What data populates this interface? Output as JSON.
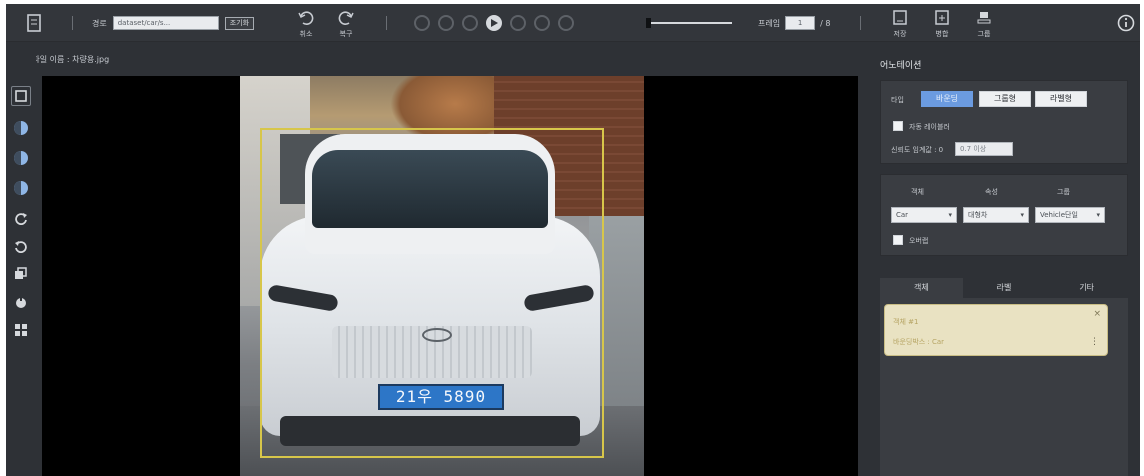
{
  "toolbar": {
    "path_label": "경로",
    "path_value": "dataset/car/s...",
    "browse_label": "조기화",
    "undo_label": "취소",
    "redo_label": "복구",
    "frame_label": "프레임",
    "frame_current": "1",
    "frame_total": "/ 8",
    "save_label": "저장",
    "export_label": "병합",
    "group_label": "그룹",
    "info_icon": "info-icon"
  },
  "file": {
    "name": "파일 이름 : 차량용.jpg"
  },
  "photo": {
    "plate_text": "21우 5890"
  },
  "panel": {
    "title": "어노테이션",
    "mode_label": "타입",
    "modes": [
      "바운딩",
      "그룹형",
      "라벨형"
    ],
    "active_mode": 0,
    "auto_label": "자동 레이블러",
    "threshold_label": "신뢰도 임계값 : 0",
    "threshold_value": "0.7 이상",
    "select_labels": [
      "객체",
      "속성",
      "그룹"
    ],
    "select_values": [
      "Car",
      "대형차",
      "Vehicle단일"
    ],
    "check_label": "오버랩",
    "tabs": [
      "객체",
      "라벨",
      "기타"
    ],
    "active_tab": 0,
    "item_title": "객체 #1",
    "item_sub": "바운딩박스 : Car"
  },
  "colors": {
    "accent": "#6b9be0",
    "bbox": "#d7c64a",
    "panel": "#3a3d42",
    "background": "#2e3136"
  }
}
